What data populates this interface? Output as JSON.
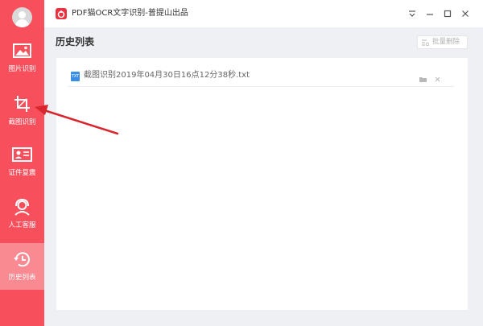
{
  "window": {
    "title": "PDF猫OCR文字识别-普提山出品",
    "controls": [
      "download-icon",
      "minimize-icon",
      "maximize-icon",
      "close-icon"
    ]
  },
  "sidebar": {
    "items": [
      {
        "label": "图片识别",
        "icon": "image-icon"
      },
      {
        "label": "截图识别",
        "icon": "crop-icon"
      },
      {
        "label": "证件复震",
        "icon": "id-card-icon"
      },
      {
        "label": "人工客服",
        "icon": "customer-service-icon"
      },
      {
        "label": "历史列表",
        "icon": "history-icon",
        "active": true
      }
    ]
  },
  "main": {
    "title": "历史列表",
    "batch_delete_label": "批量删除",
    "files": [
      {
        "name": "截图识别2019年04月30日16点12分38秒.txt",
        "ext": "TXT"
      }
    ]
  },
  "colors": {
    "sidebar": "#f74f5c",
    "sidebar_active": "#fa8a91",
    "annotation_arrow": "#d9262e"
  }
}
